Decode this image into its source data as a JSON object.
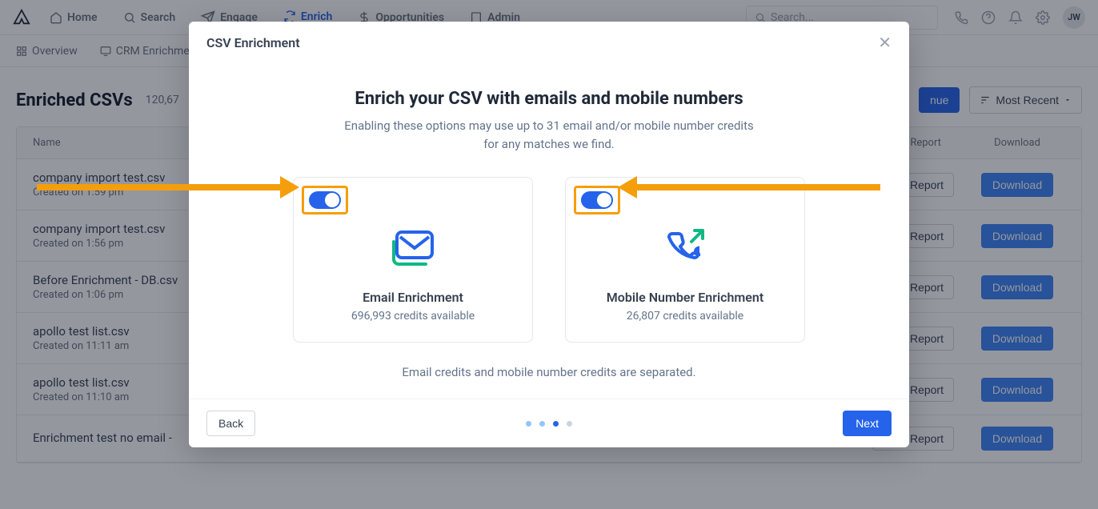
{
  "nav": {
    "items": [
      "Home",
      "Search",
      "Engage",
      "Enrich",
      "Opportunities",
      "Admin"
    ],
    "search_placeholder": "Search...",
    "avatar": "JW"
  },
  "subnav": {
    "overview": "Overview",
    "crm": "CRM Enrichment"
  },
  "page": {
    "title": "Enriched CSVs",
    "count": "120,67",
    "continue": "nue",
    "sort": "Most Recent",
    "col_name": "Name",
    "col_view": "View Report",
    "col_download": "Download",
    "view_report_label": "View Report",
    "download_label": "Download"
  },
  "rows": [
    {
      "title": "company import test.csv",
      "sub": "Created on 1:59 pm"
    },
    {
      "title": "company import test.csv",
      "sub": "Created on 1:56 pm"
    },
    {
      "title": "Before Enrichment - DB.csv",
      "sub": "Created on 1:06 pm"
    },
    {
      "title": "apollo test list.csv",
      "sub": "Created on 11:11 am"
    },
    {
      "title": "apollo test list.csv",
      "sub": "Created on 11:10 am"
    },
    {
      "title": "Enrichment test no email -",
      "sub": ""
    }
  ],
  "modal": {
    "title": "CSV Enrichment",
    "heading": "Enrich your CSV with emails and mobile numbers",
    "sub": "Enabling these options may use up to 31 email and/or mobile number credits for any matches we find.",
    "email_card_title": "Email Enrichment",
    "email_card_sub": "696,993 credits available",
    "mobile_card_title": "Mobile Number Enrichment",
    "mobile_card_sub": "26,807 credits available",
    "note": "Email credits and mobile number credits are separated.",
    "back": "Back",
    "next": "Next"
  }
}
